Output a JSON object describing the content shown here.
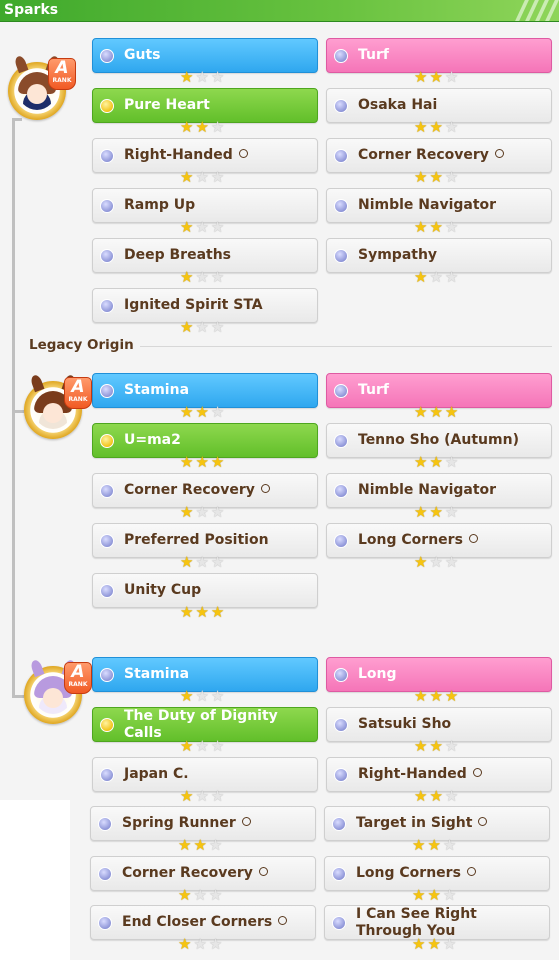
{
  "header": {
    "title": "Sparks"
  },
  "legacy_label": "Legacy Origin",
  "rank_badge": {
    "letter": "A",
    "word": "RANK"
  },
  "colors": {
    "header_green": "#4cb233",
    "blue": "#35abf0",
    "pink": "#f77dbd",
    "green": "#69c22f",
    "star_on": "#f6c410"
  },
  "avatars": [
    {
      "hair": "#8a4b2a",
      "accent": "#1e2e6a",
      "ears": "#8a4b2a"
    },
    {
      "hair": "#7a3c1c",
      "accent": "#f0e5d8",
      "ears": "#7a3c1c"
    },
    {
      "hair": "#b89adf",
      "accent": "#efe9fb",
      "ears": "#b89adf"
    }
  ],
  "sparks": [
    {
      "label": "Guts",
      "color": "blue",
      "stars": 1
    },
    {
      "label": "Turf",
      "color": "pink",
      "stars": 2
    },
    {
      "label": "Pure Heart",
      "color": "green",
      "stars": 2
    },
    {
      "label": "Osaka Hai",
      "color": "white",
      "stars": 2
    },
    {
      "label": "Right-Handed",
      "color": "white",
      "stars": 1,
      "circle": true
    },
    {
      "label": "Corner Recovery",
      "color": "white",
      "stars": 2,
      "circle": true
    },
    {
      "label": "Ramp Up",
      "color": "white",
      "stars": 1
    },
    {
      "label": "Nimble Navigator",
      "color": "white",
      "stars": 2
    },
    {
      "label": "Deep Breaths",
      "color": "white",
      "stars": 1
    },
    {
      "label": "Sympathy",
      "color": "white",
      "stars": 1
    },
    {
      "label": "Ignited Spirit STA",
      "color": "white",
      "stars": 1
    },
    {
      "label": "Stamina",
      "color": "blue",
      "stars": 2
    },
    {
      "label": "Turf",
      "color": "pink",
      "stars": 3
    },
    {
      "label": "U=ma2",
      "color": "green",
      "stars": 3
    },
    {
      "label": "Tenno Sho (Autumn)",
      "color": "white",
      "stars": 2
    },
    {
      "label": "Corner Recovery",
      "color": "white",
      "stars": 1,
      "circle": true
    },
    {
      "label": "Nimble Navigator",
      "color": "white",
      "stars": 2
    },
    {
      "label": "Preferred Position",
      "color": "white",
      "stars": 1
    },
    {
      "label": "Long Corners",
      "color": "white",
      "stars": 1,
      "circle": true
    },
    {
      "label": "Unity Cup",
      "color": "white",
      "stars": 3
    },
    {
      "label": "Stamina",
      "color": "blue",
      "stars": 1
    },
    {
      "label": "Long",
      "color": "pink",
      "stars": 3
    },
    {
      "label": "The Duty of Dignity Calls",
      "color": "green",
      "stars": 1
    },
    {
      "label": "Satsuki Sho",
      "color": "white",
      "stars": 2
    },
    {
      "label": "Japan C.",
      "color": "white",
      "stars": 1
    },
    {
      "label": "Right-Handed",
      "color": "white",
      "stars": 2,
      "circle": true
    },
    {
      "label": "Spring Runner",
      "color": "white",
      "stars": 2,
      "circle": true
    },
    {
      "label": "Target in Sight",
      "color": "white",
      "stars": 2,
      "circle": true
    },
    {
      "label": "Corner Recovery",
      "color": "white",
      "stars": 1,
      "circle": true
    },
    {
      "label": "Long Corners",
      "color": "white",
      "stars": 2,
      "circle": true
    },
    {
      "label": "End Closer Corners",
      "color": "white",
      "stars": 1,
      "circle": true
    },
    {
      "label": "I Can See Right Through You",
      "color": "white",
      "stars": 2
    }
  ]
}
